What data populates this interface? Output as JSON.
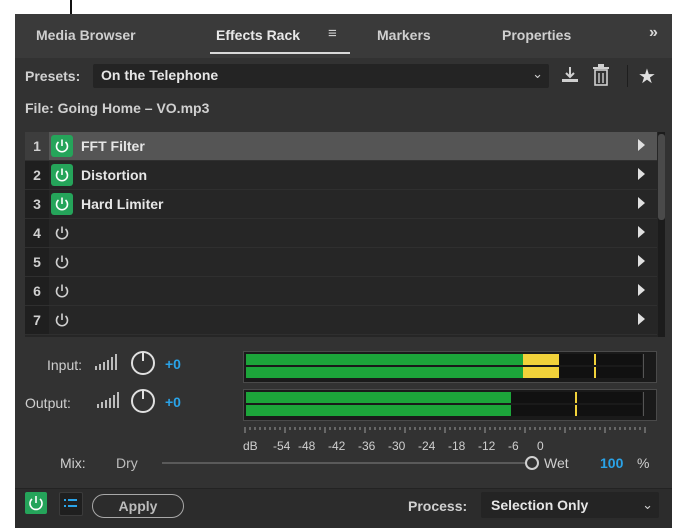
{
  "tabs": [
    {
      "label": "Media Browser",
      "active": false
    },
    {
      "label": "Effects Rack",
      "active": true
    },
    {
      "label": "Markers",
      "active": false
    },
    {
      "label": "Properties",
      "active": false
    }
  ],
  "overflow_label": "»",
  "presets": {
    "label": "Presets:",
    "selected": "On the Telephone"
  },
  "file": {
    "label": "File: Going Home – VO.mp3"
  },
  "rack": {
    "slots": [
      {
        "num": "1",
        "name": "FFT Filter",
        "power": "on",
        "selected": true
      },
      {
        "num": "2",
        "name": "Distortion",
        "power": "on",
        "selected": false
      },
      {
        "num": "3",
        "name": "Hard Limiter",
        "power": "on",
        "selected": false
      },
      {
        "num": "4",
        "name": "",
        "power": "off",
        "selected": false
      },
      {
        "num": "5",
        "name": "",
        "power": "off",
        "selected": false
      },
      {
        "num": "6",
        "name": "",
        "power": "off",
        "selected": false
      },
      {
        "num": "7",
        "name": "",
        "power": "off",
        "selected": false
      }
    ]
  },
  "input": {
    "label": "Input:",
    "gain": "+0",
    "meter_green_fraction": 0.7,
    "meter_yellow_fraction": 0.09,
    "peak_fraction": 0.88
  },
  "output": {
    "label": "Output:",
    "gain": "+0",
    "meter_green_fraction": 0.67,
    "meter_yellow_fraction": 0.0,
    "peak_fraction": 0.83
  },
  "scale": [
    "dB",
    "-54",
    "-48",
    "-42",
    "-36",
    "-30",
    "-24",
    "-18",
    "-12",
    "-6",
    "0"
  ],
  "mix": {
    "label": "Mix:",
    "dry": "Dry",
    "wet": "Wet",
    "value": "100",
    "unit": "%"
  },
  "bottom": {
    "apply": "Apply",
    "process_label": "Process:",
    "process_value": "Selection Only"
  },
  "colors": {
    "accent_green": "#25a45a",
    "meter_green": "#1ca53a",
    "meter_yellow": "#f1d23a",
    "value_blue": "#2aa3e8"
  }
}
